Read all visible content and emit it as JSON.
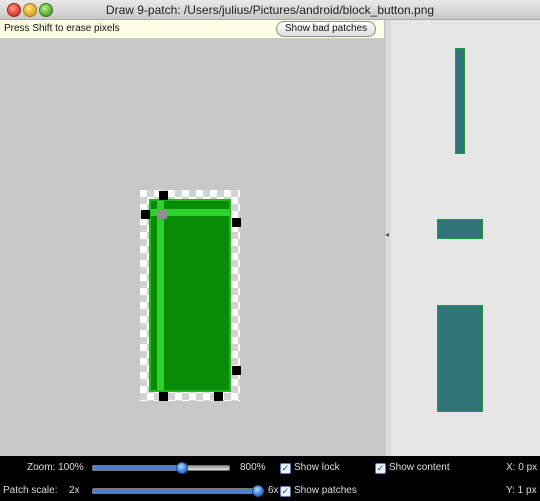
{
  "window": {
    "title": "Draw 9-patch: /Users/julius/Pictures/android/block_button.png"
  },
  "hintbar": {
    "hint": "Press Shift to erase pixels",
    "bad_patches_label": "Show bad patches"
  },
  "controls": {
    "zoom_label": "Zoom: 100%",
    "zoom_max_label": "800%",
    "zoom_value_fraction": 0.65,
    "patch_scale_label": "Patch scale:",
    "patch_scale_min": "2x",
    "patch_scale_max": "6x",
    "patch_scale_value_fraction": 1.0,
    "show_lock": {
      "label": "Show lock",
      "checked": true
    },
    "show_patches": {
      "label": "Show patches",
      "checked": true
    },
    "show_content": {
      "label": "Show content",
      "checked": true
    },
    "x_readout": "X: 0 px",
    "y_readout": "Y: 1 px"
  },
  "colors": {
    "patch_green": "#078c07",
    "highlight_green": "#2dd22d",
    "preview_fill": "#2e7478"
  },
  "icons": {
    "check": "✓"
  }
}
